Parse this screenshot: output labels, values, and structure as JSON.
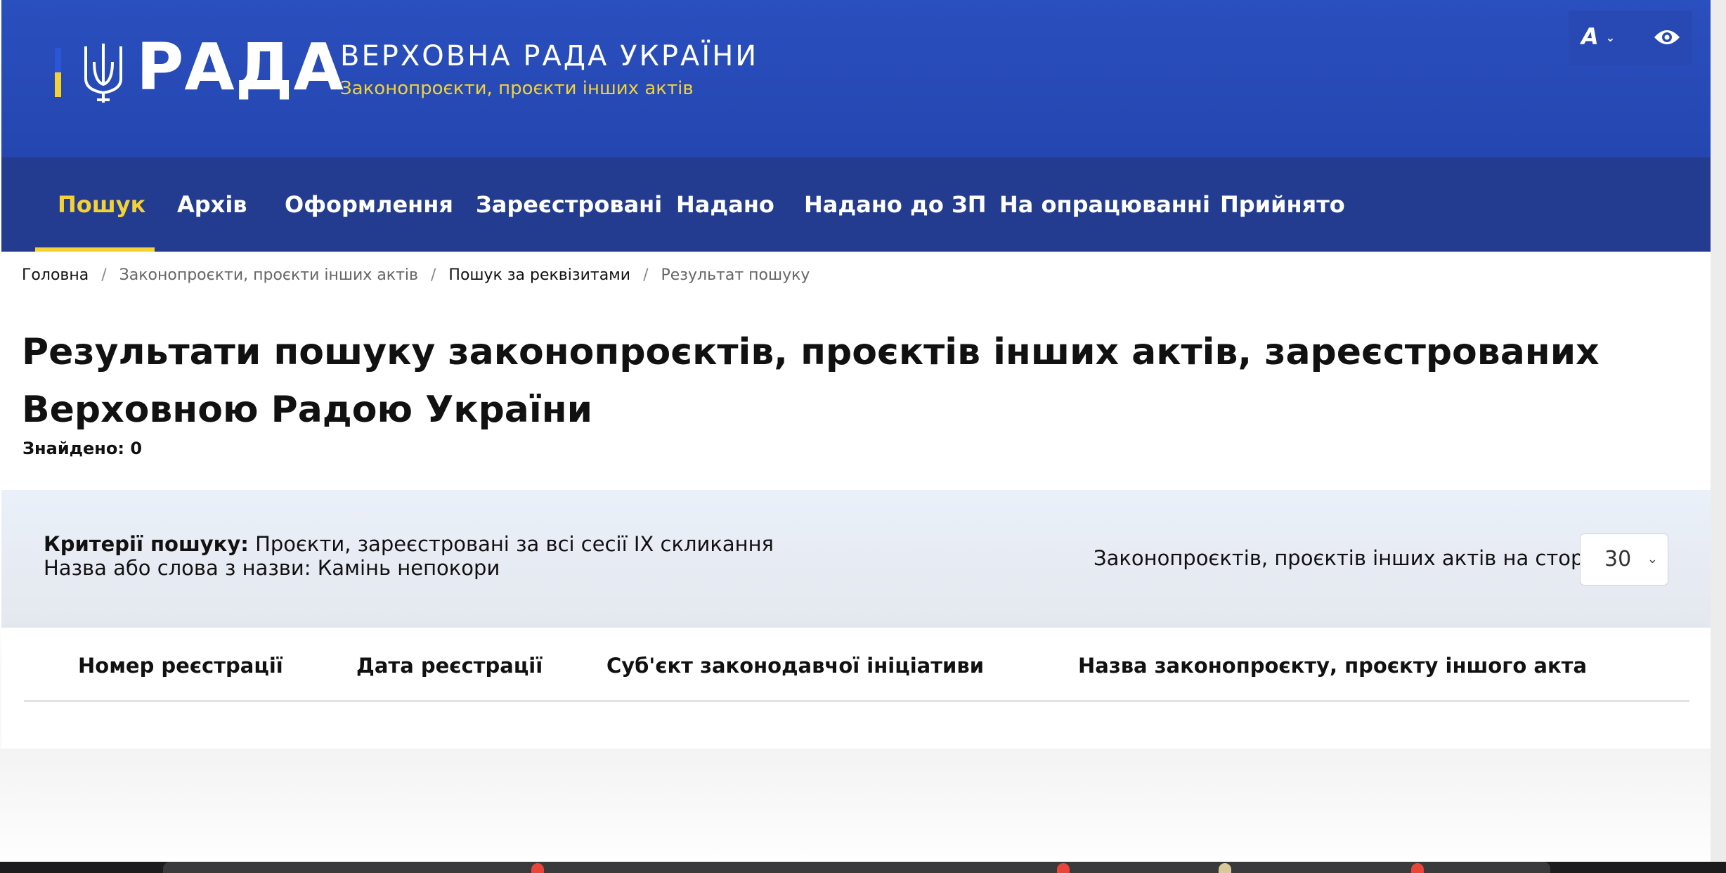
{
  "header": {
    "logo_text": "РАДА",
    "org_title": "ВЕРХОВНА РАДА УКРАЇНИ",
    "org_subtitle": "Законопроєкти, проєкти інших актів",
    "font_size_toggle": "A",
    "icons": [
      "trident-icon",
      "chevron-down-icon",
      "eye-icon"
    ]
  },
  "nav": {
    "items": [
      {
        "label": "Пошук",
        "active": true
      },
      {
        "label": "Архів"
      },
      {
        "label": "Оформлення"
      },
      {
        "label": "Зареєстровані"
      },
      {
        "label": "Надано"
      },
      {
        "label": "Надано до ЗП"
      },
      {
        "label": "На опрацюванні"
      },
      {
        "label": "Прийнято"
      }
    ]
  },
  "breadcrumb": [
    {
      "label": "Головна"
    },
    {
      "label": "Законопроєкти, проєкти інших актів"
    },
    {
      "label": "Пошук за реквізитами"
    },
    {
      "label": "Результат пошуку"
    }
  ],
  "page": {
    "title": "Результати пошуку законопроєктів, проєктів інших актів, зареєстрованих Верховною Радою України",
    "found_label": "Знайдено: 0"
  },
  "criteria": {
    "label": "Критерії пошуку:",
    "value": "Проєкти, зареєстровані за всі сесії IX скликання",
    "name_line": "Назва або слова з назви: Камінь непокори"
  },
  "per_page": {
    "label": "Законопроєктів, проєктів інших актів на сторінці",
    "value": "30"
  },
  "table": {
    "columns": [
      "Номер реєстрації",
      "Дата реєстрації",
      "Суб'єкт законодавчої ініціативи",
      "Назва законопроєкту, проєкту іншого акта"
    ]
  },
  "colors": {
    "header_blue": "#2a4fbe",
    "nav_blue": "#233c8f",
    "accent_yellow": "#f4d234"
  }
}
